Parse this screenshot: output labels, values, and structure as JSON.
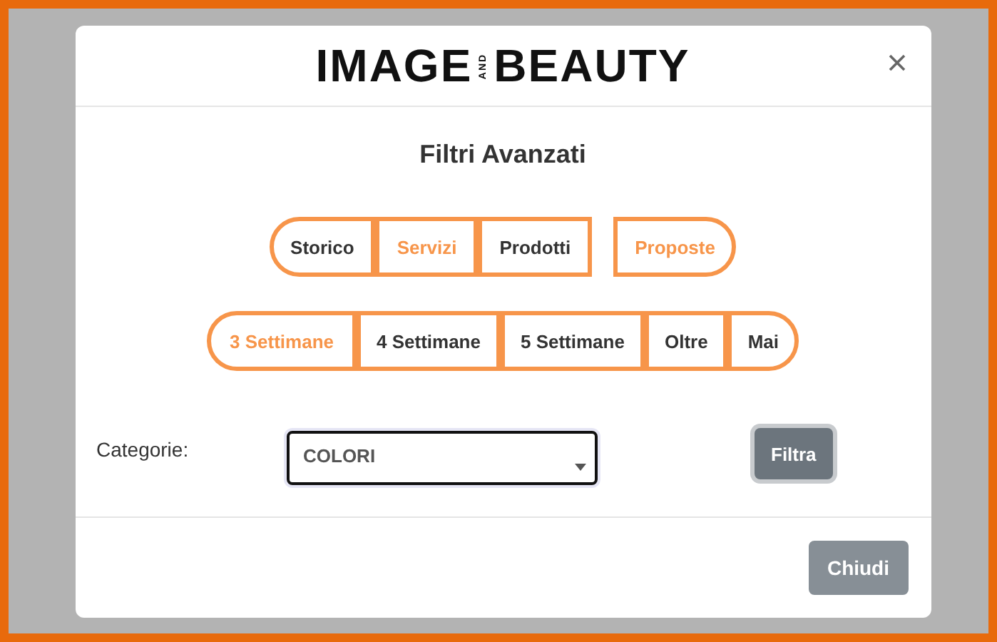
{
  "logo": {
    "left": "IMAGE",
    "middle": "AND",
    "right": "BEAUTY"
  },
  "title": "Filtri Avanzati",
  "type_filters": [
    {
      "label": "Storico",
      "selected": false,
      "kind": "attached"
    },
    {
      "label": "Servizi",
      "selected": true,
      "kind": "attached"
    },
    {
      "label": "Prodotti",
      "selected": false,
      "kind": "attached"
    },
    {
      "label": "Proposte",
      "selected": true,
      "kind": "detached"
    }
  ],
  "period_filters": [
    {
      "label": "3 Settimane",
      "selected": true
    },
    {
      "label": "4 Settimane",
      "selected": false
    },
    {
      "label": "5 Settimane",
      "selected": false
    },
    {
      "label": "Oltre",
      "selected": false
    },
    {
      "label": "Mai",
      "selected": false
    }
  ],
  "category": {
    "label": "Categorie:",
    "value": "COLORI"
  },
  "filter_button": "Filtra",
  "close_button": "Chiudi"
}
